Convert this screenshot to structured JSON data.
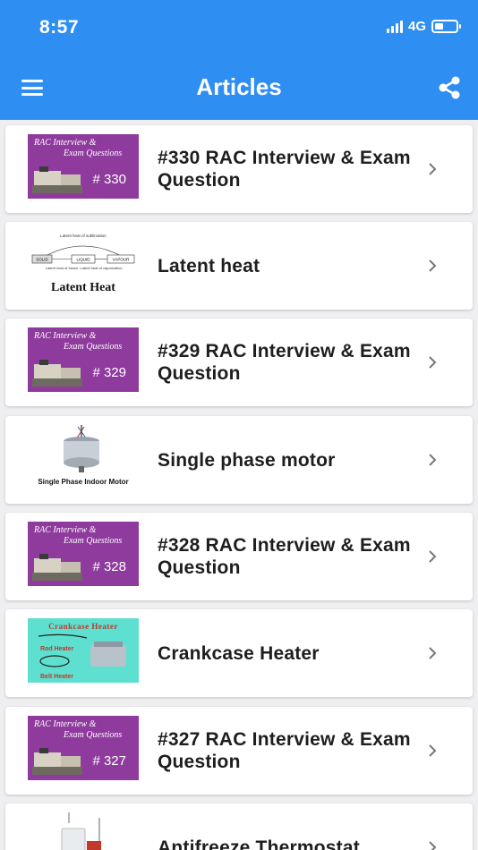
{
  "status_bar": {
    "time": "8:57",
    "network": "4G"
  },
  "header": {
    "title": "Articles",
    "menu_icon": "hamburger-menu-icon",
    "share_icon": "share-icon"
  },
  "articles": [
    {
      "title": "#330 RAC Interview & Exam Question",
      "thumb": "rac",
      "thumb_text": [
        "RAC Interview &",
        "Exam Questions",
        "# 330"
      ]
    },
    {
      "title": "Latent heat",
      "thumb": "latent",
      "thumb_text": [
        "Latent Heat"
      ]
    },
    {
      "title": "#329 RAC Interview & Exam Question",
      "thumb": "rac",
      "thumb_text": [
        "RAC Interview &",
        "Exam Questions",
        "# 329"
      ]
    },
    {
      "title": "Single phase motor",
      "thumb": "motor",
      "thumb_text": [
        "Single Phase Indoor Motor"
      ]
    },
    {
      "title": "#328 RAC Interview & Exam Question",
      "thumb": "rac",
      "thumb_text": [
        "RAC Interview &",
        "Exam Questions",
        "# 328"
      ]
    },
    {
      "title": "Crankcase Heater",
      "thumb": "crank",
      "thumb_text": [
        "Crankcase Heater",
        "Rod Heater",
        "Belt Heater"
      ]
    },
    {
      "title": "#327 RAC Interview & Exam Question",
      "thumb": "rac",
      "thumb_text": [
        "RAC Interview &",
        "Exam Questions",
        "# 327"
      ]
    },
    {
      "title": "Antifreeze Thermostat",
      "thumb": "thermo",
      "thumb_text": []
    }
  ],
  "latent_diagram": {
    "top_label": "Latent heat of sublimation",
    "boxes": [
      "SOLID",
      "LIQUID",
      "VAPOUR"
    ],
    "bottom_left": "Latent heat of fusion",
    "bottom_right": "Latent heat of vaporization"
  },
  "colors": {
    "header": "#2e8ef2",
    "rac_purple": "#8e3b9d",
    "crank_teal": "#5de0cf"
  }
}
